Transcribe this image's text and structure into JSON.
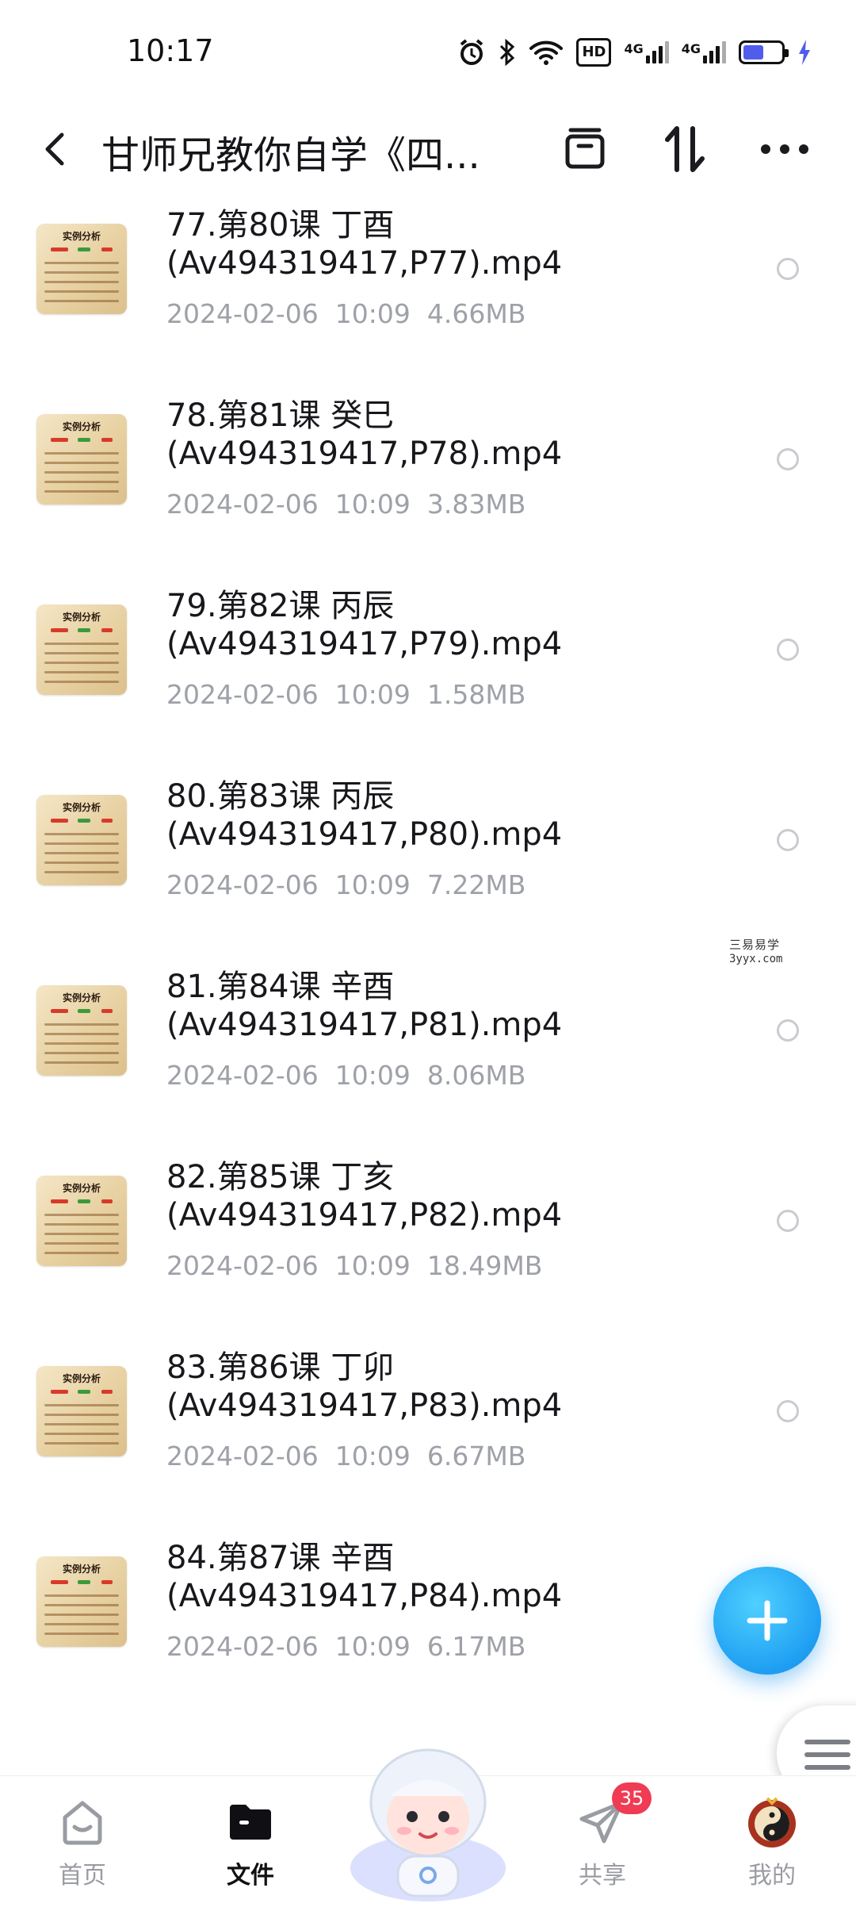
{
  "status_bar": {
    "time": "10:17",
    "network_1": "4G",
    "network_2": "4G",
    "hd_label": "HD",
    "battery_level": 0.6,
    "icons": [
      "alarm-icon",
      "bluetooth-icon",
      "wifi-icon",
      "hd-voice-icon",
      "signal-icon",
      "signal-icon",
      "battery-icon",
      "charging-icon"
    ]
  },
  "header": {
    "title": "甘师兄教你自学《四...",
    "actions": [
      "archive-icon",
      "sort-icon",
      "more-icon"
    ]
  },
  "files": [
    {
      "name_line1": "77.第80课 丁酉",
      "name_line2": "(Av494319417,P77).mp4",
      "date": "2024-02-06  10:09",
      "size": "4.66MB"
    },
    {
      "name_line1": "78.第81课 癸巳",
      "name_line2": "(Av494319417,P78).mp4",
      "date": "2024-02-06  10:09",
      "size": "3.83MB"
    },
    {
      "name_line1": "79.第82课 丙辰",
      "name_line2": "(Av494319417,P79).mp4",
      "date": "2024-02-06  10:09",
      "size": "1.58MB"
    },
    {
      "name_line1": "80.第83课 丙辰",
      "name_line2": "(Av494319417,P80).mp4",
      "date": "2024-02-06  10:09",
      "size": "7.22MB"
    },
    {
      "name_line1": "81.第84课 辛酉",
      "name_line2": "(Av494319417,P81).mp4",
      "date": "2024-02-06  10:09",
      "size": "8.06MB"
    },
    {
      "name_line1": "82.第85课 丁亥",
      "name_line2": "(Av494319417,P82).mp4",
      "date": "2024-02-06  10:09",
      "size": "18.49MB"
    },
    {
      "name_line1": "83.第86课 丁卯",
      "name_line2": "(Av494319417,P83).mp4",
      "date": "2024-02-06  10:09",
      "size": "6.67MB"
    },
    {
      "name_line1": "84.第87课 辛酉",
      "name_line2": "(Av494319417,P84).mp4",
      "date": "2024-02-06  10:09",
      "size": "6.17MB"
    }
  ],
  "thumbnail_title": "实例分析",
  "watermark": {
    "line1": "三易易学",
    "line2": "3yyx.com"
  },
  "nav": {
    "home": "首页",
    "files": "文件",
    "share": "共享",
    "share_badge": "35",
    "mine": "我的"
  },
  "colors": {
    "accent": "#1f9ff2",
    "badge": "#f03b54",
    "meta_text": "#9ea1a8"
  }
}
